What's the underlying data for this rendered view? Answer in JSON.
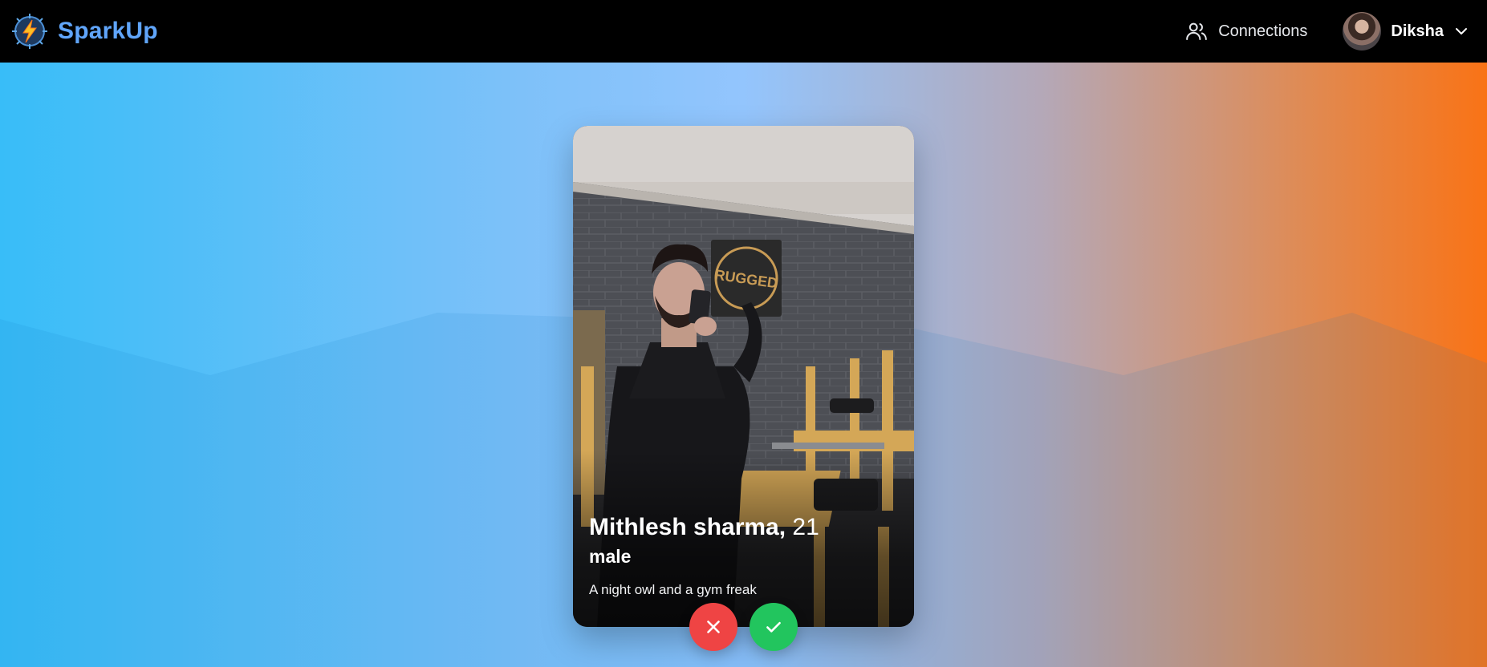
{
  "brand": {
    "name": "SparkUp",
    "logo_icon": "spark-logo-icon"
  },
  "nav": {
    "connections_label": "Connections",
    "connections_icon": "users-icon",
    "user_name": "Diksha",
    "menu_icon": "chevron-down-icon"
  },
  "card": {
    "name": "Mithlesh sharma,",
    "age": "21",
    "gender": "male",
    "bio": "A night owl and a gym freak",
    "photo_text": "RUGGED"
  },
  "actions": {
    "pass_icon": "close-icon",
    "like_icon": "check-icon",
    "pass_color": "#ef4444",
    "like_color": "#22c55e"
  },
  "theme": {
    "navbar_bg": "#000000",
    "brand_color": "#60a5fa",
    "gradient_left": "#38bdf8",
    "gradient_right": "#f97316"
  }
}
